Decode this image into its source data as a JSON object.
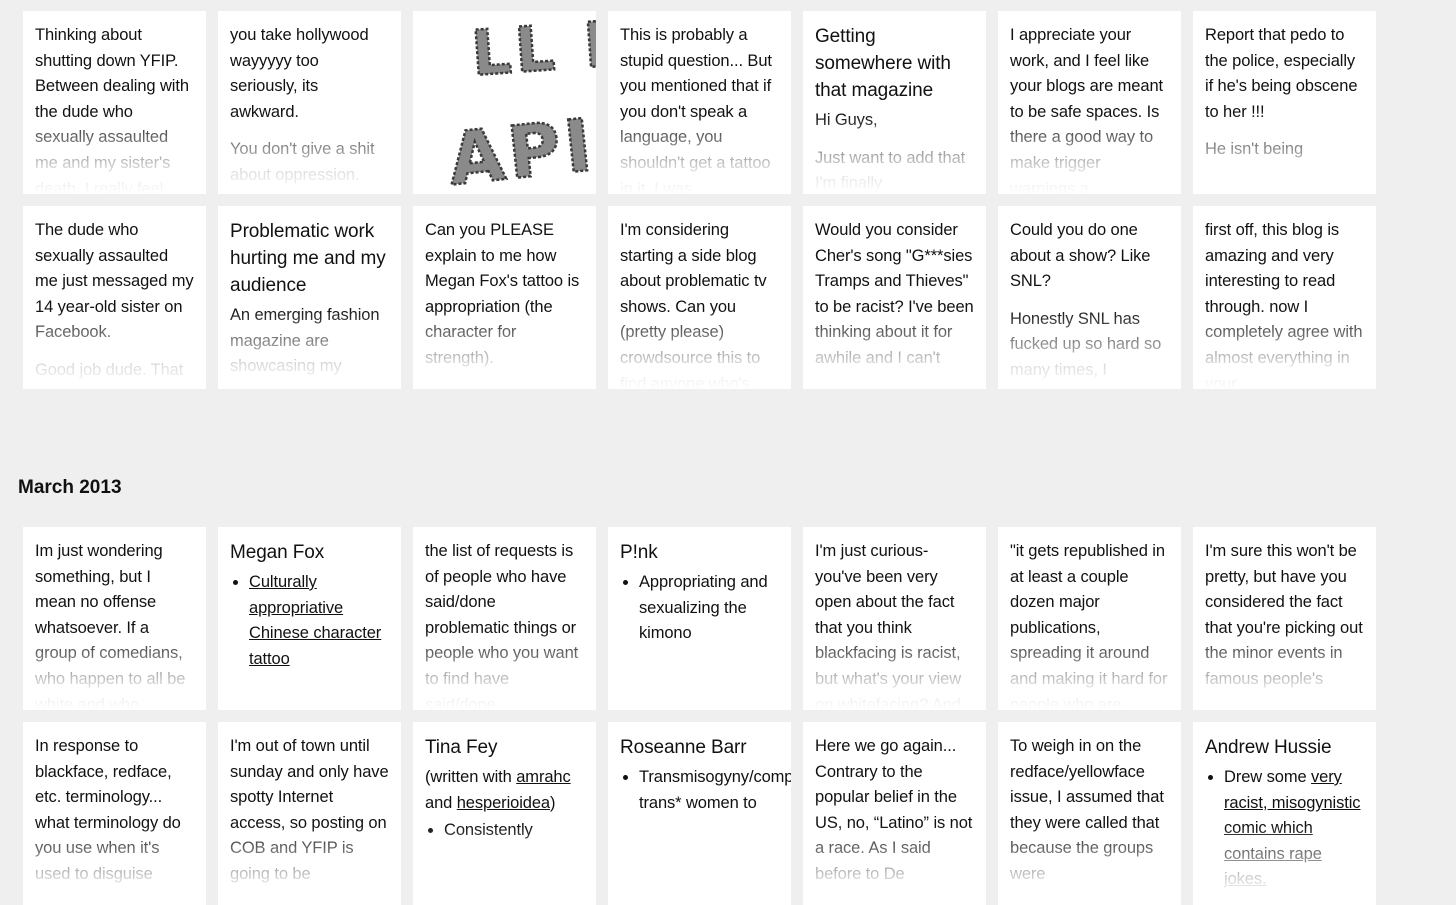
{
  "section1": {
    "cards": [
      {
        "body": [
          "Thinking about shutting down YFIP. Between dealing with the dude who sexually assaulted me and my sister's death, I really feel"
        ]
      },
      {
        "body": [
          "you take hollywood wayyyyy too seriously, its awkward.",
          "You don't give a shit about oppression."
        ]
      },
      {
        "image": true,
        "image_text": [
          "LL L",
          "APIST"
        ]
      },
      {
        "body": [
          "This is probably a stupid question... But you mentioned that if you don't speak a language, you shouldn't get a tattoo in it. I was"
        ]
      },
      {
        "title": "Getting somewhere with that magazine",
        "body": [
          "Hi Guys,",
          "Just want to add that I'm finally"
        ]
      },
      {
        "body": [
          "I appreciate your work, and I feel like your blogs are meant to be safe spaces. Is there a good way to make trigger warnings a"
        ]
      },
      {
        "body": [
          "Report that pedo to the police, especially if he's being obscene to her !!!",
          "He isn't being"
        ]
      },
      {
        "body": [
          "The dude who sexually assaulted me just messaged my 14 year-old sister on Facebook.",
          "Good job dude. That"
        ]
      },
      {
        "title": "Problematic work hurting me and my audience",
        "body": [
          "An emerging fashion magazine are showcasing my"
        ]
      },
      {
        "body": [
          "Can you PLEASE explain to me how Megan Fox's tattoo is appropriation (the character for strength)."
        ]
      },
      {
        "body": [
          "I'm considering starting a side blog about problematic tv shows. Can you (pretty please) crowdsource this to find anyone who's"
        ]
      },
      {
        "body": [
          "Would you consider Cher's song \"G***sies Tramps and Thieves\" to be racist? I've been thinking about it for awhile and I can't"
        ]
      },
      {
        "body": [
          "Could you do one about a show? Like SNL?",
          "Honestly SNL has fucked up so hard so many times, I"
        ]
      },
      {
        "body": [
          "first off, this blog is amazing and very interesting to read through. now I completely agree with almost everything in your"
        ]
      }
    ]
  },
  "month_heading": "March 2013",
  "section2": {
    "cards": [
      {
        "body": [
          "Im just wondering something, but I mean no offense whatsoever. If a group of comedians, who happen to all be white and who"
        ]
      },
      {
        "title": "Megan Fox",
        "bullets": [
          {
            "link": "Culturally appropriative Chinese character tattoo"
          }
        ]
      },
      {
        "body": [
          "the list of requests is of people who have said/done problematic things or people who you want to find have said/done"
        ]
      },
      {
        "title": "P!nk",
        "bullets": [
          {
            "text": "Appropriating and sexualizing the kimono"
          }
        ]
      },
      {
        "body": [
          "I'm just curious- you've been very open about the fact that you think blackfacing is racist, but what's your view on whitefacing? And"
        ]
      },
      {
        "body": [
          "\"it gets republished in at least a couple dozen major publications, spreading it around and making it hard for people who are"
        ]
      },
      {
        "body": [
          "I'm sure this won't be pretty, but have you considered the fact that you're picking out the minor events in famous people's"
        ]
      },
      {
        "body": [
          "In response to blackface, redface, etc.  terminology... what terminology do you use when it's used to disguise"
        ]
      },
      {
        "body": [
          "I'm out of town until sunday and only have spotty Internet access, so posting on COB and YFIP is going to be"
        ]
      },
      {
        "title": "Tina Fey",
        "credit": {
          "pre": "(written with ",
          "link1": "amrahc",
          "mid": " and ",
          "link2": "hesperioidea",
          "post": ")"
        },
        "bullets": [
          {
            "text": "Consistently"
          }
        ]
      },
      {
        "title": "Roseanne Barr",
        "bullets": [
          {
            "text": "Transmisogyny/comparing trans* women to"
          }
        ]
      },
      {
        "body": [
          "Here we go again... Contrary to the popular belief in the US, no, “Latino” is not a race. As I said before to De"
        ]
      },
      {
        "body": [
          "To weigh in on the redface/yellowface issue, I assumed that they were called that because the groups were"
        ]
      },
      {
        "title": "Andrew Hussie",
        "bullets": [
          {
            "pre": "Drew some ",
            "link": "very racist, misogynistic comic which contains rape jokes."
          }
        ]
      }
    ]
  }
}
